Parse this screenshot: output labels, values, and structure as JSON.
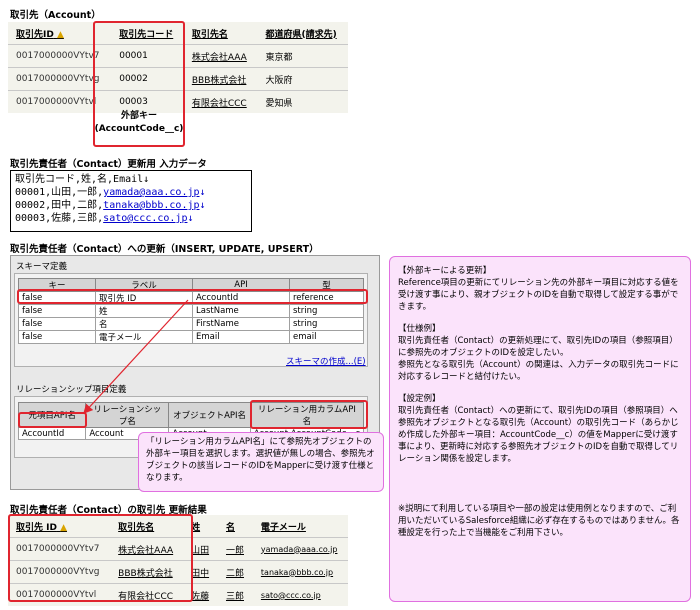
{
  "account": {
    "title": "取引先（Account）",
    "headers": [
      "取引先ID",
      "取引先コード",
      "取引先名",
      "都道府県(請求先)"
    ],
    "rows": [
      [
        "0017000000VYtv7",
        "00001",
        "株式会社AAA",
        "東京都"
      ],
      [
        "0017000000VYtvg",
        "00002",
        "BBB株式会社",
        "大阪府"
      ],
      [
        "0017000000VYtvl",
        "00003",
        "有限会社CCC",
        "愛知県"
      ]
    ],
    "fk_label_1": "外部キー",
    "fk_label_2": "(AccountCode__c)"
  },
  "input": {
    "title": "取引先責任者（Contact）更新用 入力データ",
    "lines": [
      {
        "text": "取引先コード,姓,名,Email↓",
        "email": ""
      },
      {
        "text": "00001,山田,一郎,",
        "email": "yamada@aaa.co.jp",
        "tail": "↓"
      },
      {
        "text": "00002,田中,二郎,",
        "email": "tanaka@bbb.co.jp",
        "tail": "↓"
      },
      {
        "text": "00003,佐藤,三郎,",
        "email": "sato@ccc.co.jp",
        "tail": "↓"
      }
    ]
  },
  "update": {
    "title": "取引先責任者（Contact）への更新（INSERT, UPDATE, UPSERT）",
    "schema_title": "スキーマ定義",
    "schema_headers": [
      "キー",
      "ラベル",
      "API",
      "型"
    ],
    "schema_rows": [
      [
        "false",
        "取引先 ID",
        "AccountId",
        "reference"
      ],
      [
        "false",
        "姓",
        "LastName",
        "string"
      ],
      [
        "false",
        "名",
        "FirstName",
        "string"
      ],
      [
        "false",
        "電子メール",
        "Email",
        "email"
      ]
    ],
    "schema_link": "スキーマの作成...(E)",
    "relation_title": "リレーションシップ項目定義",
    "relation_headers": [
      "元項目API名",
      "リレーションシップ名",
      "オブジェクトAPI名",
      "リレーション用カラムAPI名"
    ],
    "relation_row": [
      "AccountId",
      "Account",
      "Account",
      "Account.AccountCode__c"
    ]
  },
  "callout": {
    "text": "「リレーション用カラムAPI名」にて参照先オブジェクトの外部キー項目を選択します。選択値が無しの場合、参照先オブジェクトの該当レコードのIDをMapperに受け渡す仕様となります。"
  },
  "result": {
    "title": "取引先責任者（Contact）の取引先 更新結果",
    "headers": [
      "取引先 ID",
      "取引先名",
      "姓",
      "名",
      "電子メール"
    ],
    "rows": [
      [
        "0017000000VYtv7",
        "株式会社AAA",
        "山田",
        "一郎",
        "yamada@aaa.co.jp"
      ],
      [
        "0017000000VYtvg",
        "BBB株式会社",
        "田中",
        "二郎",
        "tanaka@bbb.co.jp"
      ],
      [
        "0017000000VYtvl",
        "有限会社CCC",
        "佐藤",
        "三郎",
        "sato@ccc.co.jp"
      ]
    ]
  },
  "note": {
    "h1": "【外部キーによる更新】",
    "p1": "Reference項目の更新にてリレーション先の外部キー項目に対応する値を受け渡す事により、親オブジェクトのIDを自動で取得して設定する事ができます。",
    "h2": "【仕様例】",
    "p2a": "取引先責任者（Contact）の更新処理にて、取引先IDの項目（参照項目）に参照先のオブジェクトのIDを設定したい。",
    "p2b": "参照先となる取引先（Account）の関連は、入力データの取引先コードに対応するレコードと結付けたい。",
    "h3": "【設定例】",
    "p3": "取引先責任者（Contact）への更新にて、取引先IDの項目（参照項目）へ参照先オブジェクトとなる取引先（Account）の取引先コード（あらかじめ作成した外部キー項目：AccountCode__c）の値をMapperに受け渡す事により、更新時に対応する参照先オブジェクトのIDを自動で取得してリレーション関係を設定します。",
    "p4": "※説明にて利用している項目や一部の設定は使用例となりますので、ご利用いただいているSalesforce組織に必ず存在するものではありません。各種設定を行った上で当機能をご利用下さい。"
  },
  "colors": {
    "red": "#e0252f",
    "pink_bg": "#fbe3fb",
    "pink_border": "#e070e0",
    "link": "#0000cc"
  }
}
